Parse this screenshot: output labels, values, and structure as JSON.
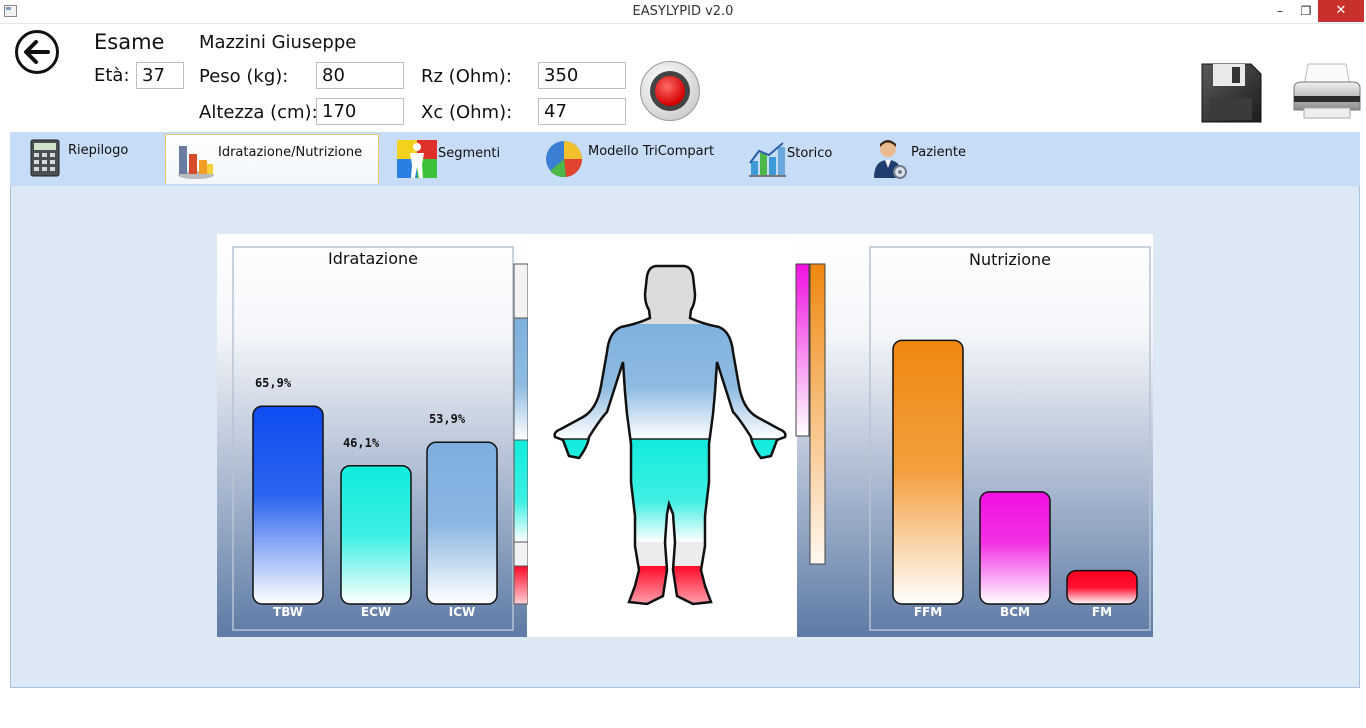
{
  "window": {
    "title": "EASYLYPID v2.0",
    "min_glyph": "–",
    "max_glyph": "❐",
    "close_glyph": "✕"
  },
  "header": {
    "exam_label": "Esame",
    "patient_name": "Mazzini Giuseppe",
    "age_label": "Età:",
    "age_value": "37",
    "weight_label": "Peso (kg):",
    "weight_value": "80",
    "height_label": "Altezza (cm):",
    "height_value": "170",
    "rz_label": "Rz (Ohm):",
    "rz_value": "350",
    "xc_label": "Xc (Ohm):",
    "xc_value": "47"
  },
  "tabs": [
    {
      "label": "Riepilogo",
      "icon": "calculator-icon",
      "active": false
    },
    {
      "label": "Idratazione/Nutrizione",
      "icon": "bar-chart-icon",
      "active": true
    },
    {
      "label": "Segmenti",
      "icon": "body-segments-icon",
      "active": false
    },
    {
      "label": "Modello TriCompart",
      "icon": "pie-chart-icon",
      "active": false
    },
    {
      "label": "Storico",
      "icon": "history-chart-icon",
      "active": false
    },
    {
      "label": "Paziente",
      "icon": "patient-icon",
      "active": false
    }
  ],
  "report": {
    "hydration_title": "Idratazione",
    "nutrition_title": "Nutrizione"
  },
  "chart_data": [
    {
      "type": "bar",
      "title": "Idratazione",
      "categories": [
        "TBW",
        "ECW",
        "ICW"
      ],
      "values": [
        65.9,
        46.1,
        53.9
      ],
      "value_labels": [
        "65,9%",
        "46,1%",
        "53,9%"
      ],
      "colors": [
        "#1250f0",
        "#10ecdc",
        "#7eaedf"
      ],
      "ylim": [
        0,
        100
      ]
    },
    {
      "type": "bar",
      "title": "Nutrizione",
      "categories": [
        "FFM",
        "BCM",
        "FM"
      ],
      "values": [
        87,
        37,
        11
      ],
      "colors": [
        "#f0880f",
        "#f010e0",
        "#ff0020"
      ],
      "ylim": [
        0,
        100
      ]
    }
  ],
  "colors": {
    "tab_bar": "#c6dcf7",
    "content_bg": "#dde8f5",
    "close_button": "#c7302c"
  }
}
